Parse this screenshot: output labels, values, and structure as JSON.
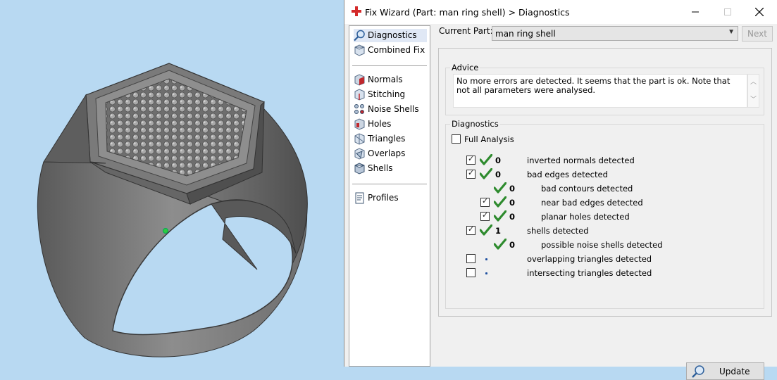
{
  "window": {
    "title": "Fix Wizard (Part: man ring shell) > Diagnostics"
  },
  "nav": {
    "items_top": [
      {
        "label": "Diagnostics",
        "icon": "magnifier-icon"
      },
      {
        "label": "Combined Fix",
        "icon": "combined-fix-icon"
      }
    ],
    "items_mid": [
      {
        "label": "Normals",
        "icon": "normals-icon"
      },
      {
        "label": "Stitching",
        "icon": "stitching-icon"
      },
      {
        "label": "Noise Shells",
        "icon": "noise-shells-icon"
      },
      {
        "label": "Holes",
        "icon": "holes-icon"
      },
      {
        "label": "Triangles",
        "icon": "triangles-icon"
      },
      {
        "label": "Overlaps",
        "icon": "overlaps-icon"
      },
      {
        "label": "Shells",
        "icon": "shells-icon"
      }
    ],
    "items_bottom": [
      {
        "label": "Profiles",
        "icon": "profiles-icon"
      }
    ]
  },
  "part": {
    "label": "Current Part:",
    "value": "man ring shell"
  },
  "next_label": "Next",
  "advice": {
    "title": "Advice",
    "text": "No more errors are detected. It seems that the part is ok. Note that not all parameters were analysed."
  },
  "diagnostics": {
    "title": "Diagnostics",
    "full_analysis_label": "Full Analysis",
    "full_analysis_checked": false,
    "rows": [
      {
        "checkbox": true,
        "checked": true,
        "status": "ok",
        "count": "0",
        "label": "inverted normals detected",
        "indent": 0
      },
      {
        "checkbox": true,
        "checked": true,
        "status": "ok",
        "count": "0",
        "label": "bad edges detected",
        "indent": 0
      },
      {
        "checkbox": false,
        "checked": false,
        "status": "ok",
        "count": "0",
        "label": "bad contours detected",
        "indent": 1
      },
      {
        "checkbox": true,
        "checked": true,
        "status": "ok",
        "count": "0",
        "label": "near bad edges detected",
        "indent": 1
      },
      {
        "checkbox": true,
        "checked": true,
        "status": "ok",
        "count": "0",
        "label": "planar holes detected",
        "indent": 1
      },
      {
        "checkbox": true,
        "checked": true,
        "status": "ok",
        "count": "1",
        "label": "shells detected",
        "indent": 0
      },
      {
        "checkbox": false,
        "checked": false,
        "status": "ok",
        "count": "0",
        "label": "possible noise shells detected",
        "indent": 1
      },
      {
        "checkbox": true,
        "checked": false,
        "status": "pending",
        "count": "",
        "label": "overlapping triangles detected",
        "indent": 0
      },
      {
        "checkbox": true,
        "checked": false,
        "status": "pending",
        "count": "",
        "label": "intersecting triangles detected",
        "indent": 0
      }
    ],
    "update_label": "Update"
  },
  "colors": {
    "check_green": "#2e8b2e",
    "viewport_bg": "#b8d9f2",
    "title_icon_red": "#d42a2a"
  }
}
